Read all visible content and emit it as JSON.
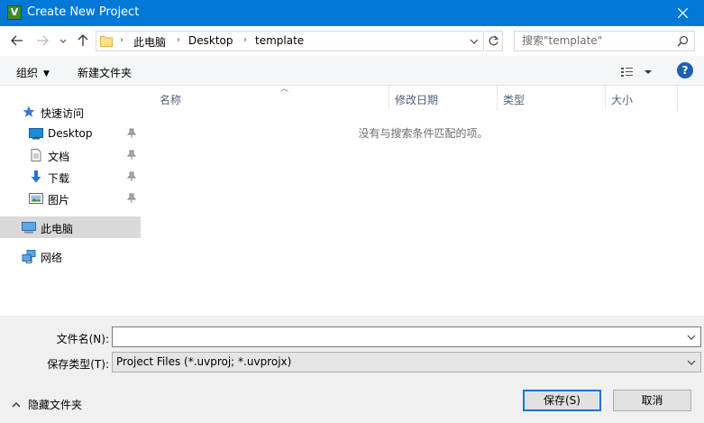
{
  "window": {
    "title": "Create New Project",
    "app_icon_glyph": "V"
  },
  "address": {
    "breadcrumbs": [
      "此电脑",
      "Desktop",
      "template"
    ],
    "search_placeholder": "搜索\"template\""
  },
  "toolbar": {
    "organize_label": "组织",
    "new_folder_label": "新建文件夹",
    "help_glyph": "?"
  },
  "nav": {
    "quick_access": "快速访问",
    "items": [
      {
        "label": "Desktop",
        "icon": "desktop-icon",
        "pinned": true
      },
      {
        "label": "文档",
        "icon": "documents-icon",
        "pinned": true
      },
      {
        "label": "下载",
        "icon": "download-icon",
        "pinned": true
      },
      {
        "label": "图片",
        "icon": "pictures-icon",
        "pinned": true
      }
    ],
    "this_pc": "此电脑",
    "network": "网络"
  },
  "filelist": {
    "columns": [
      "名称",
      "修改日期",
      "类型",
      "大小"
    ],
    "empty_message": "没有与搜索条件匹配的项。"
  },
  "bottom": {
    "filename_label": "文件名(N):",
    "filename_value": "",
    "filetype_label": "保存类型(T):",
    "filetype_value": "Project Files (*.uvproj; *.uvprojx)",
    "hide_folders_label": "隐藏文件夹",
    "save_label": "保存(S)",
    "cancel_label": "取消"
  },
  "colors": {
    "titlebar": "#0078d7",
    "selected_nav": "#d9d9d9",
    "column_header_text": "#4c607a"
  }
}
